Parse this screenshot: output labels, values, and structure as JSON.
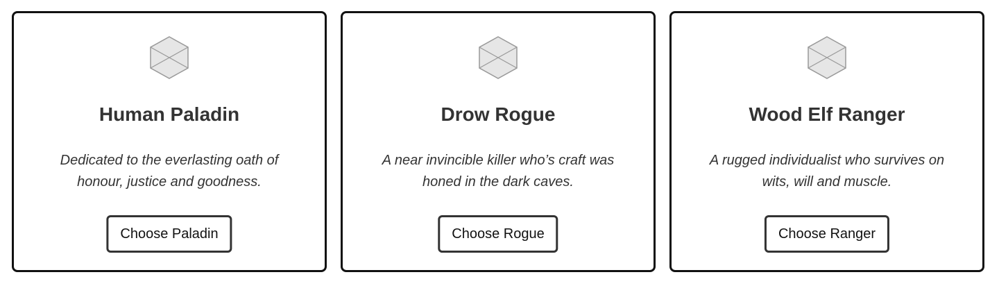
{
  "cards": [
    {
      "icon": "image-placeholder-icon",
      "title": "Human Paladin",
      "description": "Dedicated to the everlasting oath of honour, justice and goodness.",
      "button_label": "Choose Paladin"
    },
    {
      "icon": "image-placeholder-icon",
      "title": "Drow Rogue",
      "description": "A near invincible killer who’s craft was honed in the dark caves.",
      "button_label": "Choose Rogue"
    },
    {
      "icon": "image-placeholder-icon",
      "title": "Wood Elf Ranger",
      "description": "A rugged individualist who survives on wits, will and muscle.",
      "button_label": "Choose Ranger"
    }
  ],
  "colors": {
    "text": "#333333",
    "border": "#111111",
    "icon_stroke": "#999999",
    "icon_fill": "#e6e6e6",
    "background": "#ffffff"
  }
}
